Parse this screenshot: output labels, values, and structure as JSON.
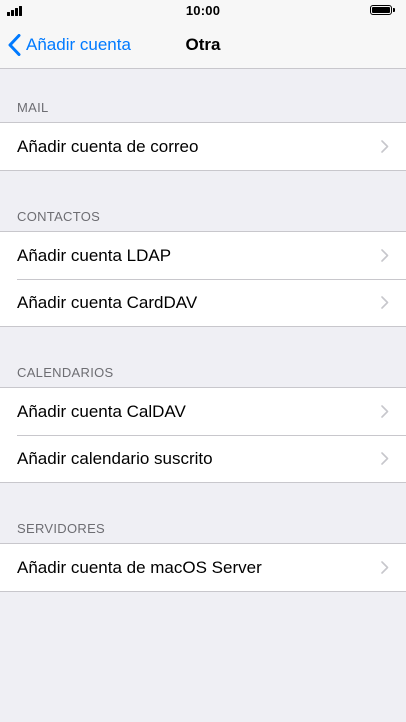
{
  "status_bar": {
    "time": "10:00",
    "signal_icon": "signal-bars-icon",
    "battery_icon": "battery-full-icon"
  },
  "nav": {
    "back_label": "Añadir cuenta",
    "back_icon": "chevron-left-icon",
    "title": "Otra",
    "accent_color": "#007aff"
  },
  "sections": [
    {
      "header": "MAIL",
      "items": [
        {
          "label": "Añadir cuenta de correo"
        }
      ]
    },
    {
      "header": "CONTACTOS",
      "items": [
        {
          "label": "Añadir cuenta LDAP"
        },
        {
          "label": "Añadir cuenta CardDAV"
        }
      ]
    },
    {
      "header": "CALENDARIOS",
      "items": [
        {
          "label": "Añadir cuenta CalDAV"
        },
        {
          "label": "Añadir calendario suscrito"
        }
      ]
    },
    {
      "header": "SERVIDORES",
      "items": [
        {
          "label": "Añadir cuenta de macOS Server"
        }
      ]
    }
  ]
}
